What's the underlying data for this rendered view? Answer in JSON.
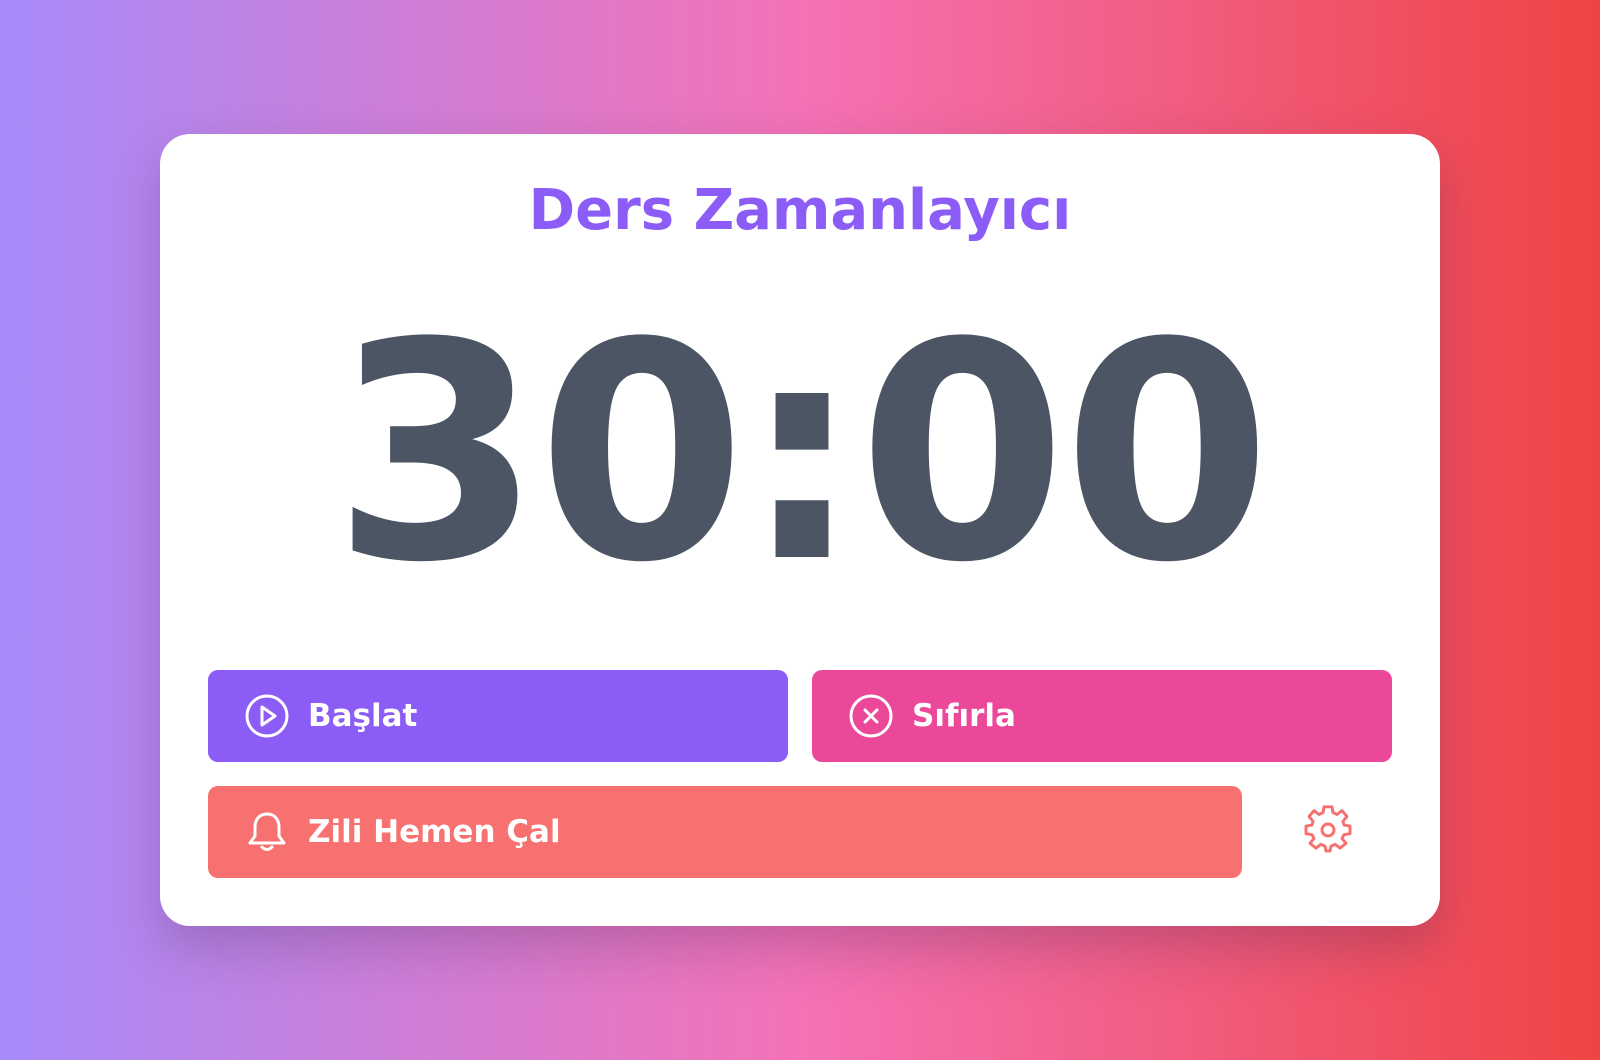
{
  "app": {
    "title": "Ders Zamanlayıcı"
  },
  "timer": {
    "display": "30:00"
  },
  "controls": {
    "start_label": "Başlat",
    "reset_label": "Sıfırla",
    "bell_label": "Zili Hemen Çal"
  },
  "icons": {
    "start": "play-circle-icon",
    "reset": "x-circle-icon",
    "bell": "bell-icon",
    "settings": "gear-icon"
  },
  "colors": {
    "title": "#8b5cf6",
    "timer": "#4b5563",
    "start_button": "#8b5cf6",
    "reset_button": "#ec4899",
    "bell_button": "#f87171",
    "settings_icon": "#f87171"
  }
}
